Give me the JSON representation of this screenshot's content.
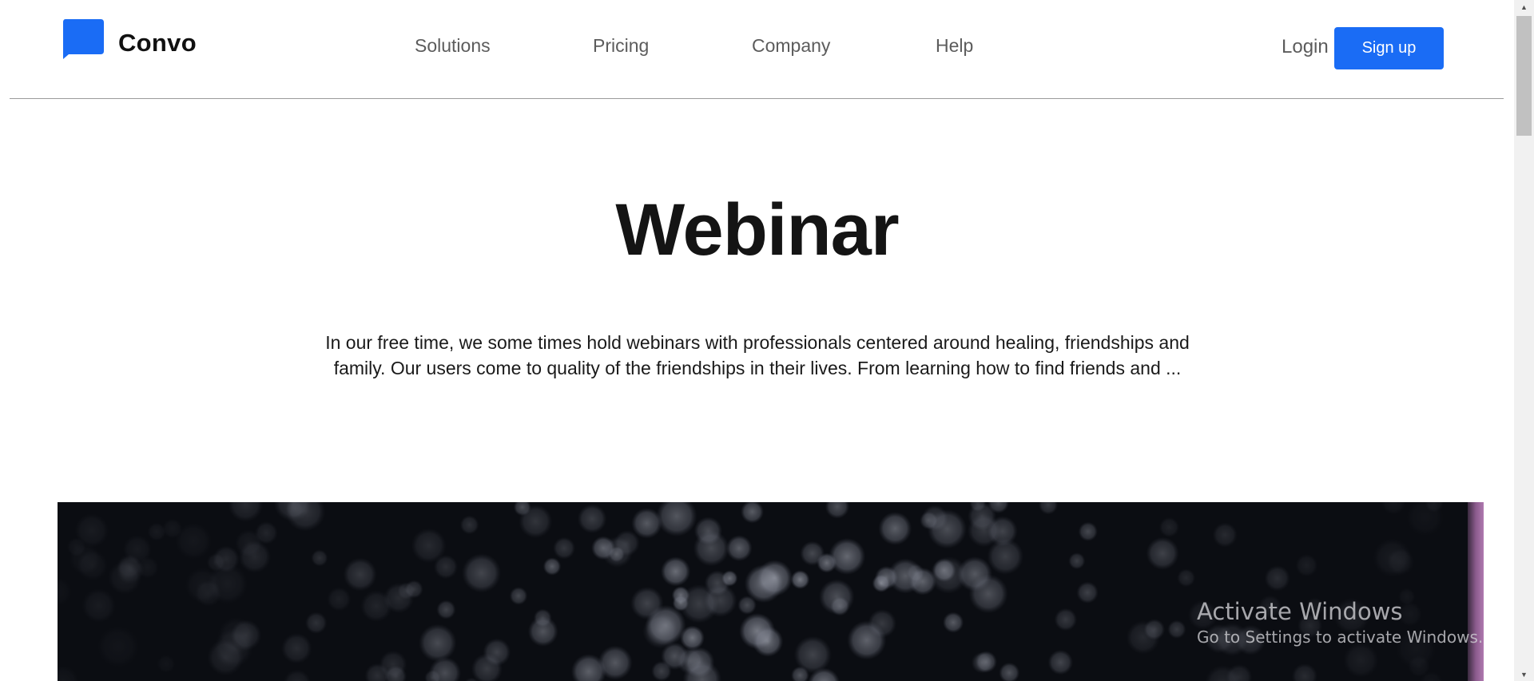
{
  "header": {
    "brand": "Convo",
    "brand_color": "#1a6cf5",
    "logo_icon": "chat-bubble-icon",
    "nav": [
      {
        "label": "Solutions"
      },
      {
        "label": "Pricing"
      },
      {
        "label": "Company"
      },
      {
        "label": "Help"
      }
    ],
    "login_label": "Login",
    "signup_label": "Sign up"
  },
  "hero": {
    "title": "Webinar",
    "description": "In our free time, we some times hold webinars with professionals centered around healing, friendships and family. Our users come to quality of the friendships in their lives. From learning how to find friends and ..."
  },
  "banner": {
    "image": "dark-bokeh-lights-photo"
  },
  "watermark": {
    "title": "Activate Windows",
    "subtitle": "Go to Settings to activate Windows."
  },
  "scrollbar": {
    "up_icon": "scroll-up-arrow-icon",
    "down_icon": "scroll-down-arrow-icon"
  }
}
